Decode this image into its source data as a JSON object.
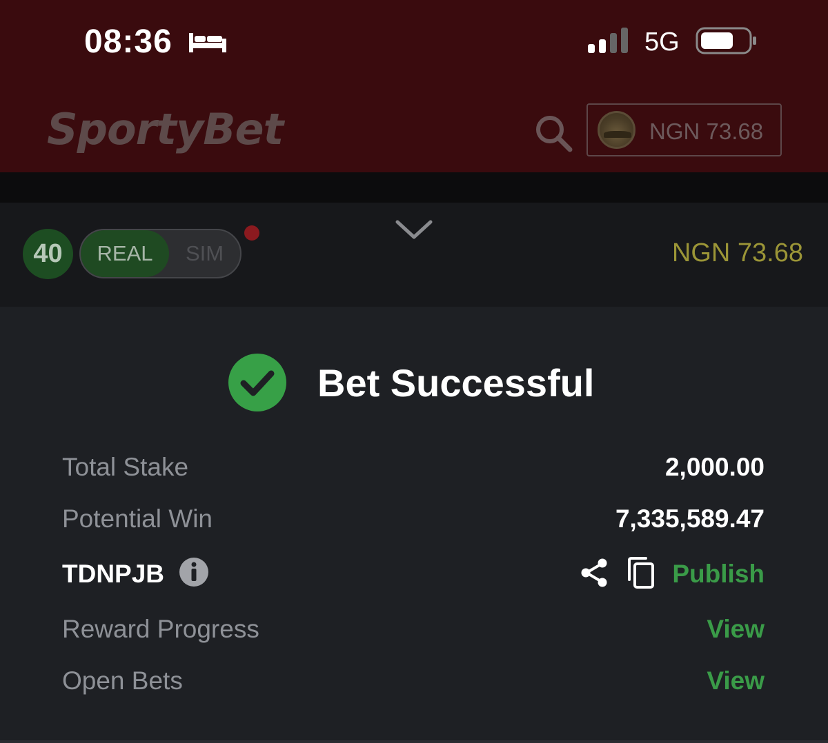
{
  "status_bar": {
    "time": "08:36",
    "network": "5G",
    "icons": [
      "bed-icon",
      "signal-icon",
      "battery-icon"
    ]
  },
  "header": {
    "logo": "SportyBet",
    "balance": "NGN 73.68",
    "icons": [
      "search-icon",
      "avatar"
    ]
  },
  "bet_bar": {
    "count": "40",
    "toggle_real": "REAL",
    "toggle_sim": "SIM",
    "balance": "NGN 73.68",
    "icons": [
      "chevron-down-icon"
    ]
  },
  "result": {
    "title": "Bet Successful",
    "rows": {
      "total_stake_label": "Total Stake",
      "total_stake_value": "2,000.00",
      "potential_win_label": "Potential Win",
      "potential_win_value": "7,335,589.47",
      "booking_code": "TDNPJB",
      "publish_label": "Publish",
      "reward_progress_label": "Reward Progress",
      "reward_progress_action": "View",
      "open_bets_label": "Open Bets",
      "open_bets_action": "View"
    }
  },
  "colors": {
    "header_bg": "#3a0b0e",
    "accent_green": "#3a9b48",
    "balance_yellow": "#9b9537",
    "panel_bg": "#1e2024"
  }
}
